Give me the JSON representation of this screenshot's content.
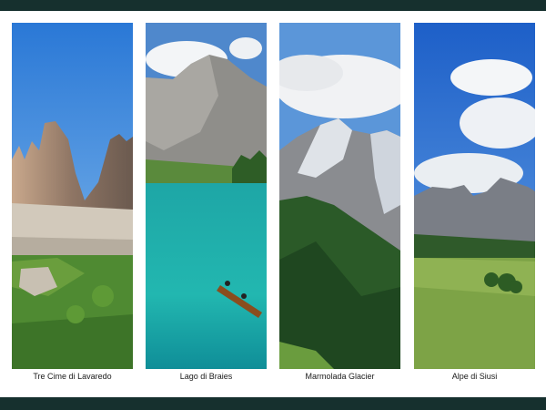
{
  "colors": {
    "band": "#16302e",
    "background": "#ffffff",
    "caption": "#1a1a1a"
  },
  "panels": [
    {
      "name": "tre-cime",
      "caption": "Tre Cime di Lavaredo"
    },
    {
      "name": "lago-di-braies",
      "caption": "Lago di Braies"
    },
    {
      "name": "marmolada",
      "caption": "Marmolada Glacier"
    },
    {
      "name": "alpe-di-siusi",
      "caption": "Alpe di Siusi"
    }
  ]
}
